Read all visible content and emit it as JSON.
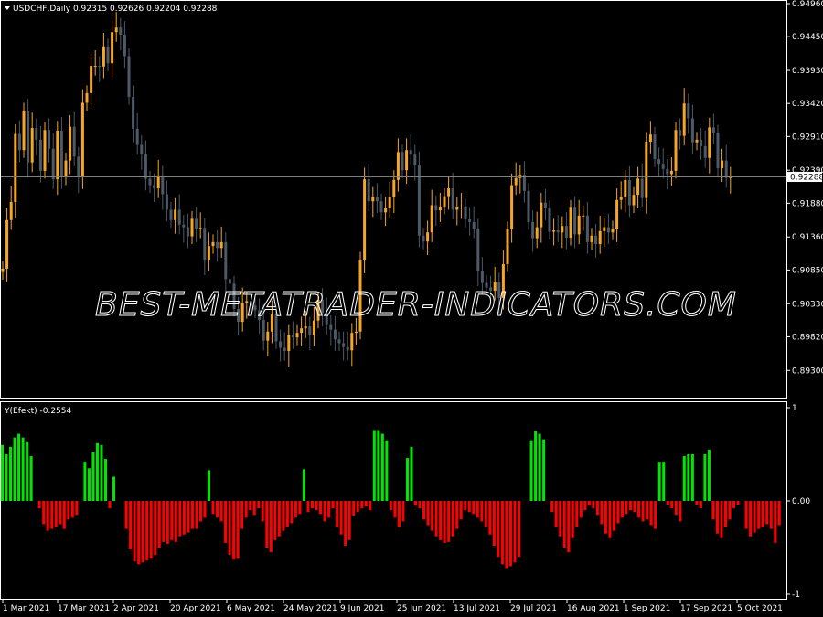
{
  "main_chart": {
    "header": "USDCHF,Daily  0.92315 0.92626 0.92204 0.92288",
    "current_price": "0.92288",
    "watermark": "BEST-METATRADER-INDICATORS.COM"
  },
  "indicator": {
    "header": "Y(Efekt) -0.2554"
  },
  "colors": {
    "background": "#000000",
    "bull_candle": "#f5a623",
    "bear_candle": "#4c5a68",
    "hist_positive": "#00e600",
    "hist_negative": "#ff0000",
    "border": "#ffffff"
  },
  "chart_data": [
    {
      "type": "candlestick",
      "title": "USDCHF,Daily",
      "ylim": [
        0.8905,
        0.9496
      ],
      "y_ticks": [
        "0.94960",
        "0.94450",
        "0.93930",
        "0.93420",
        "0.92910",
        "0.92390",
        "0.91880",
        "0.91360",
        "0.90850",
        "0.90330",
        "0.89820",
        "0.89300"
      ],
      "x_ticks": [
        "1 Mar 2021",
        "17 Mar 2021",
        "2 Apr 2021",
        "20 Apr 2021",
        "6 May 2021",
        "24 May 2021",
        "9 Jun 2021",
        "25 Jun 2021",
        "13 Jul 2021",
        "29 Jul 2021",
        "16 Aug 2021",
        "1 Sep 2021",
        "17 Sep 2021",
        "5 Oct 2021"
      ],
      "close": [
        0.9087,
        0.9162,
        0.919,
        0.9295,
        0.927,
        0.9331,
        0.9251,
        0.9304,
        0.9286,
        0.9238,
        0.9301,
        0.9272,
        0.9225,
        0.93,
        0.9228,
        0.9254,
        0.9306,
        0.926,
        0.9228,
        0.9343,
        0.9358,
        0.94,
        0.94,
        0.9399,
        0.943,
        0.9404,
        0.9452,
        0.9459,
        0.9448,
        0.9415,
        0.9352,
        0.9303,
        0.9278,
        0.9264,
        0.9226,
        0.9216,
        0.9211,
        0.9231,
        0.9202,
        0.9178,
        0.9162,
        0.9178,
        0.9155,
        0.9151,
        0.9137,
        0.9164,
        0.9149,
        0.915,
        0.9101,
        0.9122,
        0.9128,
        0.9119,
        0.9128,
        0.9071,
        0.9064,
        0.9025,
        0.9005,
        0.9034,
        0.9037,
        0.903,
        0.9023,
        0.9008,
        0.8976,
        0.899,
        0.9017,
        0.8975,
        0.8965,
        0.896,
        0.8985,
        0.8981,
        0.8988,
        0.8995,
        0.8998,
        0.8985,
        0.9007,
        0.9039,
        0.9019,
        0.9,
        0.8993,
        0.8978,
        0.8972,
        0.8966,
        0.8961,
        0.8988,
        0.899,
        0.9101,
        0.9225,
        0.9191,
        0.9198,
        0.9191,
        0.9174,
        0.918,
        0.9197,
        0.9224,
        0.9267,
        0.9239,
        0.927,
        0.9263,
        0.9247,
        0.9138,
        0.9129,
        0.9143,
        0.9185,
        0.9177,
        0.9183,
        0.9199,
        0.9211,
        0.9178,
        0.9182,
        0.9183,
        0.9163,
        0.9159,
        0.9149,
        0.9084,
        0.9065,
        0.9058,
        0.9053,
        0.9066,
        0.9042,
        0.9094,
        0.9148,
        0.9216,
        0.9227,
        0.9232,
        0.9207,
        0.9159,
        0.9134,
        0.9151,
        0.9189,
        0.918,
        0.9144,
        0.9146,
        0.9143,
        0.9153,
        0.9135,
        0.9181,
        0.914,
        0.9169,
        0.9169,
        0.9128,
        0.9138,
        0.9125,
        0.9145,
        0.9151,
        0.9143,
        0.9149,
        0.9193,
        0.9198,
        0.9224,
        0.9185,
        0.9201,
        0.9226,
        0.9196,
        0.9283,
        0.9294,
        0.9256,
        0.9249,
        0.9241,
        0.9233,
        0.9238,
        0.9301,
        0.9292,
        0.9342,
        0.9319,
        0.9282,
        0.9286,
        0.9276,
        0.9258,
        0.9305,
        0.9297,
        0.9242,
        0.9254,
        0.9227,
        0.9229
      ],
      "open": [
        0.9082,
        0.9087,
        0.9162,
        0.919,
        0.9295,
        0.927,
        0.9331,
        0.9251,
        0.9304,
        0.9286,
        0.9238,
        0.9301,
        0.9272,
        0.9225,
        0.93,
        0.9228,
        0.9254,
        0.9306,
        0.926,
        0.9228,
        0.9343,
        0.9358,
        0.94,
        0.94,
        0.9399,
        0.943,
        0.9404,
        0.9452,
        0.9459,
        0.9448,
        0.9415,
        0.9352,
        0.9303,
        0.9278,
        0.9264,
        0.9226,
        0.9216,
        0.9211,
        0.9231,
        0.9202,
        0.9178,
        0.9162,
        0.9178,
        0.9155,
        0.9151,
        0.9137,
        0.9164,
        0.9149,
        0.915,
        0.9101,
        0.9122,
        0.9128,
        0.9119,
        0.9128,
        0.9071,
        0.9064,
        0.9025,
        0.9005,
        0.9034,
        0.9037,
        0.903,
        0.9023,
        0.9008,
        0.8976,
        0.899,
        0.9017,
        0.8975,
        0.8965,
        0.896,
        0.8985,
        0.8981,
        0.8988,
        0.8995,
        0.8998,
        0.8985,
        0.9007,
        0.9039,
        0.9019,
        0.9,
        0.8993,
        0.8978,
        0.8972,
        0.8966,
        0.8961,
        0.8988,
        0.899,
        0.9101,
        0.9225,
        0.9191,
        0.9198,
        0.9191,
        0.9174,
        0.918,
        0.9197,
        0.9224,
        0.9267,
        0.9239,
        0.927,
        0.9263,
        0.9247,
        0.9138,
        0.9129,
        0.9143,
        0.9185,
        0.9177,
        0.9183,
        0.9199,
        0.9211,
        0.9178,
        0.9182,
        0.9183,
        0.9163,
        0.9159,
        0.9149,
        0.9084,
        0.9065,
        0.9058,
        0.9053,
        0.9066,
        0.9042,
        0.9094,
        0.9148,
        0.9216,
        0.9227,
        0.9232,
        0.9207,
        0.9159,
        0.9134,
        0.9151,
        0.9189,
        0.918,
        0.9144,
        0.9146,
        0.9143,
        0.9153,
        0.9135,
        0.9181,
        0.914,
        0.9169,
        0.9169,
        0.9128,
        0.9138,
        0.9125,
        0.9145,
        0.9151,
        0.9143,
        0.9149,
        0.9193,
        0.9198,
        0.9224,
        0.9185,
        0.9201,
        0.9226,
        0.9196,
        0.9283,
        0.9294,
        0.9256,
        0.9249,
        0.9241,
        0.9233,
        0.9238,
        0.9301,
        0.9292,
        0.9342,
        0.9319,
        0.9282,
        0.9286,
        0.9276,
        0.9258,
        0.9305,
        0.9297,
        0.9242,
        0.9254,
        0.9227
      ],
      "current_price": 0.92288
    },
    {
      "type": "bar",
      "title": "Y(Efekt) -0.2554",
      "ylim": [
        -1,
        1
      ],
      "y_ticks": [
        "1",
        "0.00",
        "-1"
      ],
      "values": [
        0.6,
        0.5,
        0.58,
        0.68,
        0.72,
        0.68,
        0.63,
        0.48,
        0.0,
        -0.08,
        -0.25,
        -0.32,
        -0.3,
        -0.28,
        -0.25,
        -0.3,
        -0.2,
        -0.18,
        -0.15,
        0.0,
        0.42,
        0.35,
        0.52,
        0.62,
        0.6,
        0.45,
        -0.08,
        0.26,
        0.0,
        0.0,
        -0.3,
        -0.52,
        -0.65,
        -0.68,
        -0.66,
        -0.64,
        -0.62,
        -0.58,
        -0.5,
        -0.44,
        -0.46,
        -0.42,
        -0.44,
        -0.38,
        -0.36,
        -0.34,
        -0.3,
        -0.3,
        -0.22,
        -0.18,
        0.33,
        -0.14,
        -0.18,
        -0.22,
        -0.45,
        -0.58,
        -0.63,
        -0.62,
        -0.3,
        -0.18,
        -0.1,
        -0.15,
        -0.08,
        -0.22,
        -0.5,
        -0.55,
        -0.42,
        -0.38,
        -0.32,
        -0.28,
        -0.24,
        -0.18,
        -0.14,
        0.34,
        -0.12,
        -0.08,
        -0.1,
        -0.14,
        -0.22,
        -0.18,
        -0.08,
        -0.28,
        -0.36,
        -0.48,
        -0.42,
        -0.16,
        -0.12,
        -0.08,
        -0.06,
        -0.1,
        0.76,
        0.76,
        0.72,
        0.65,
        -0.1,
        -0.18,
        -0.28,
        -0.22,
        0.46,
        0.58,
        -0.05,
        -0.08,
        -0.2,
        -0.26,
        -0.32,
        -0.38,
        -0.42,
        -0.45,
        -0.44,
        -0.38,
        -0.3,
        -0.2,
        -0.1,
        -0.12,
        -0.14,
        -0.18,
        -0.22,
        -0.28,
        -0.36,
        -0.48,
        -0.6,
        -0.68,
        -0.72,
        -0.7,
        -0.66,
        -0.6,
        0.0,
        0.0,
        0.65,
        0.75,
        0.72,
        0.66,
        0.0,
        -0.12,
        -0.28,
        -0.38,
        -0.5,
        -0.55,
        -0.4,
        -0.28,
        -0.18,
        -0.1,
        -0.05,
        -0.08,
        -0.15,
        -0.25,
        -0.35,
        -0.4,
        -0.32,
        -0.24,
        -0.18,
        -0.14,
        -0.1,
        -0.12,
        -0.18,
        -0.22,
        -0.2,
        -0.26,
        -0.3,
        0.42,
        0.42,
        -0.04,
        -0.08,
        -0.15,
        -0.22,
        0.48,
        0.5,
        0.5,
        -0.04,
        -0.08,
        0.5,
        0.55,
        -0.2,
        -0.35,
        -0.4,
        -0.28,
        -0.2,
        -0.08,
        -0.04,
        0.0,
        -0.3,
        -0.38,
        -0.34,
        -0.3,
        -0.28,
        -0.25,
        -0.3,
        -0.45,
        -0.26
      ]
    }
  ]
}
